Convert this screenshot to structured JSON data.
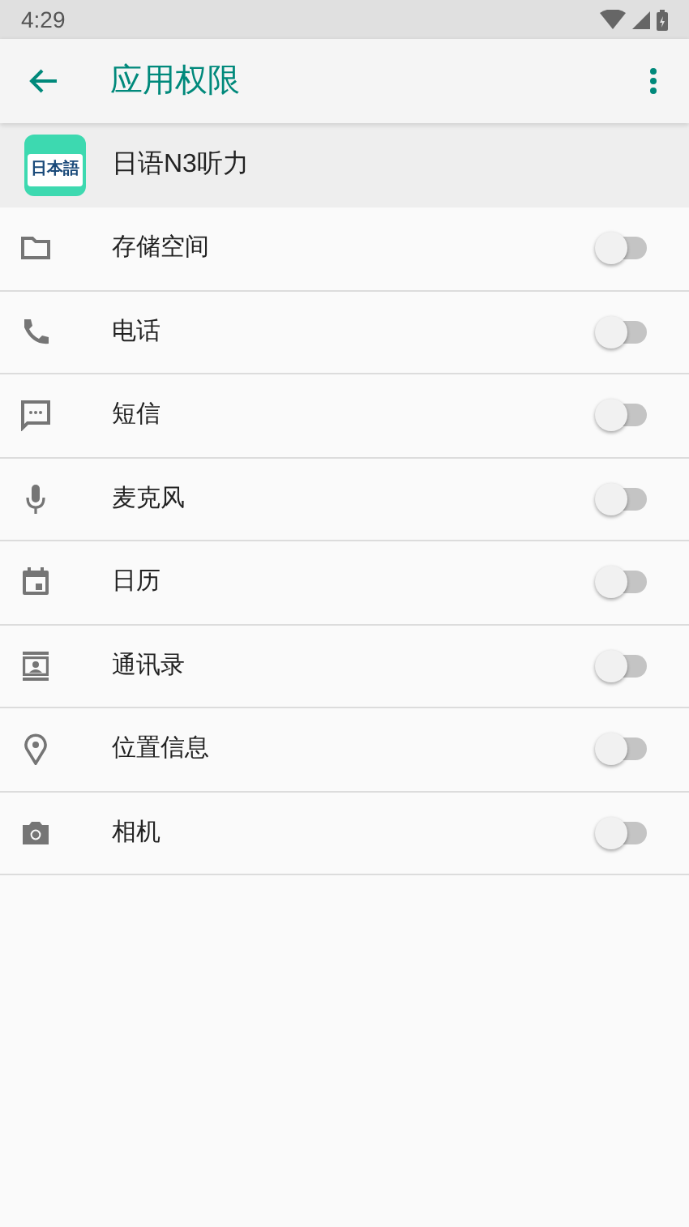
{
  "status_bar": {
    "time": "4:29"
  },
  "toolbar": {
    "title": "应用权限"
  },
  "app": {
    "name": "日语N3听力",
    "icon_label": "日本語"
  },
  "permissions": [
    {
      "label": "存储空间",
      "on": false
    },
    {
      "label": "电话",
      "on": false
    },
    {
      "label": "短信",
      "on": false
    },
    {
      "label": "麦克风",
      "on": false
    },
    {
      "label": "日历",
      "on": false
    },
    {
      "label": "通讯录",
      "on": false
    },
    {
      "label": "位置信息",
      "on": false
    },
    {
      "label": "相机",
      "on": false
    }
  ]
}
